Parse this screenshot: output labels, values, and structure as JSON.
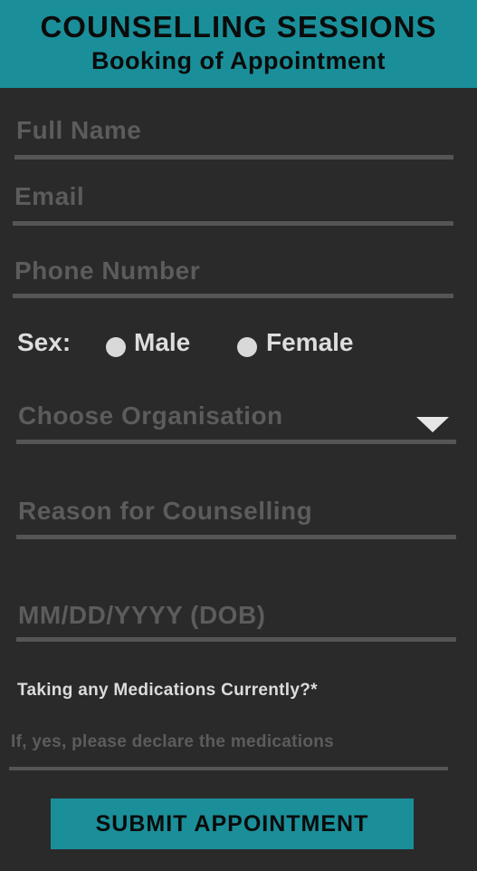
{
  "header": {
    "title": "COUNSELLING SESSIONS",
    "subtitle": "Booking of Appointment"
  },
  "form": {
    "full_name_placeholder": "Full Name",
    "email_placeholder": "Email",
    "phone_placeholder": "Phone Number",
    "sex_label": "Sex:",
    "sex_options": [
      "Male",
      "Female"
    ],
    "organisation_placeholder": "Choose Organisation",
    "reason_placeholder": "Reason for Counselling",
    "dob_placeholder": "MM/DD/YYYY (DOB)",
    "medications_question": "Taking any Medications Currently?*",
    "medications_placeholder": "If, yes, please declare the medications",
    "submit_label": "SUBMIT APPOINTMENT"
  },
  "colors": {
    "accent": "#1a8f99",
    "background": "#2a2a2a",
    "placeholder": "#5c5c5c",
    "underline": "#555555"
  },
  "icons": {
    "dropdown": "caret-down-icon",
    "radio": "radio-circle-icon"
  }
}
